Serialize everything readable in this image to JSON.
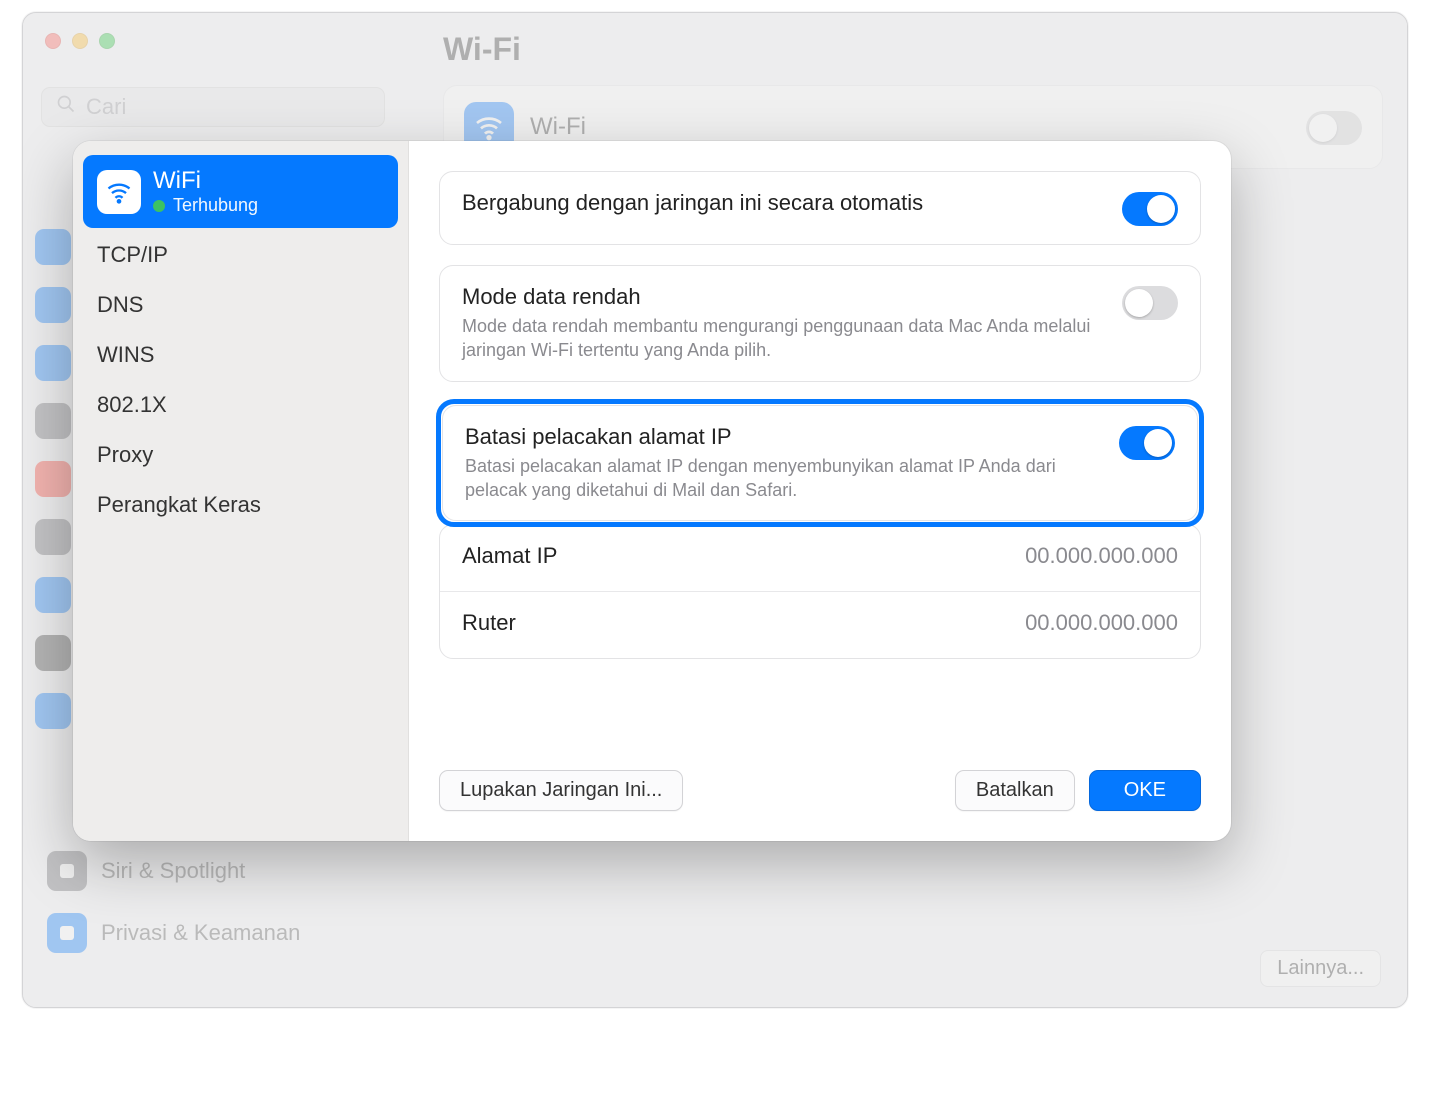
{
  "bg": {
    "window_title": "Wi-Fi",
    "search_placeholder": "Cari",
    "wifi_card_title": "Wi-Fi",
    "sidebar_items": [
      {
        "label": "Siri & Spotlight",
        "color": "#6f6f74"
      },
      {
        "label": "Privasi & Keamanan",
        "color": "#0579ff"
      }
    ],
    "slim_icons": [
      "#0579ff",
      "#0579ff",
      "#0579ff",
      "#6f6f74",
      "#ff3b30",
      "#6f6f74",
      "#0579ff",
      "#3e3e3e",
      "#0579ff"
    ],
    "more_btn": "Lainnya..."
  },
  "modal": {
    "side": {
      "wifi_label": "WiFi",
      "wifi_status": "Terhubung",
      "items": [
        {
          "label": "TCP/IP"
        },
        {
          "label": "DNS"
        },
        {
          "label": "WINS"
        },
        {
          "label": "802.1X"
        },
        {
          "label": "Proxy"
        },
        {
          "label": "Perangkat Keras"
        }
      ]
    },
    "rows": {
      "auto_join": {
        "title": "Bergabung dengan jaringan ini secara otomatis",
        "on": true
      },
      "low_data": {
        "title": "Mode data rendah",
        "desc": "Mode data rendah membantu mengurangi penggunaan data Mac Anda melalui jaringan Wi-Fi tertentu yang Anda pilih.",
        "on": false
      },
      "ip_tracking": {
        "title": "Batasi pelacakan alamat IP",
        "desc": "Batasi pelacakan alamat IP dengan menyembunyikan alamat IP Anda dari pelacak yang diketahui di Mail dan Safari.",
        "on": true
      },
      "ip_address": {
        "label": "Alamat IP",
        "value": "00.000.000.000"
      },
      "router": {
        "label": "Ruter",
        "value": "00.000.000.000"
      }
    },
    "buttons": {
      "forget": "Lupakan Jaringan Ini...",
      "cancel": "Batalkan",
      "ok": "OKE"
    }
  }
}
